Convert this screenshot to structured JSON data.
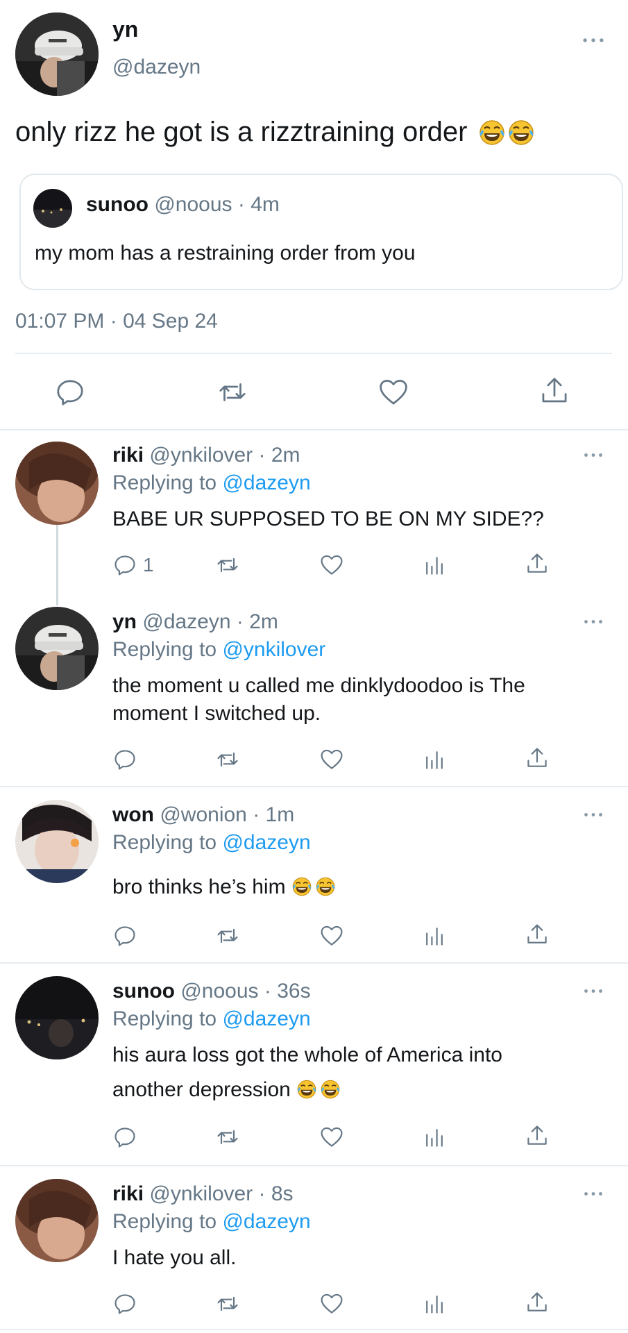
{
  "main_tweet": {
    "display_name": "yn",
    "handle": "@dazeyn",
    "text": "only rizz he got is a rizztraining order",
    "timestamp": "01:07 PM · 04 Sep 24",
    "quoted": {
      "display_name": "sunoo",
      "handle": "@noous",
      "age": "· 4m",
      "text": "my mom has a restraining order from you"
    }
  },
  "replying_prefix": "Replying to",
  "replies": [
    {
      "display_name": "riki",
      "handle": "@ynkilover",
      "age": "· 2m",
      "replying_to": "@dazeyn",
      "text": "BABE UR SUPPOSED TO BE ON MY SIDE??",
      "reply_count": "1"
    },
    {
      "display_name": "yn",
      "handle": "@dazeyn",
      "age": "· 2m",
      "replying_to": "@ynkilover",
      "text_line1": "the moment u called me dinklydoodoo is The",
      "text_line2": "moment I switched up."
    },
    {
      "display_name": "won",
      "handle": "@wonion",
      "age": "· 1m",
      "replying_to": "@dazeyn",
      "text": "bro thinks he’s him"
    },
    {
      "display_name": "sunoo",
      "handle": "@noous",
      "age": "· 36s",
      "replying_to": "@dazeyn",
      "text_line1": "his aura loss got the whole of America into",
      "text_line2": "another depression"
    },
    {
      "display_name": "riki",
      "handle": "@ynkilover",
      "age": "· 8s",
      "replying_to": "@dazeyn",
      "text": "I hate you all."
    }
  ],
  "icons": [
    "more-icon",
    "reply-icon",
    "retweet-icon",
    "like-icon",
    "share-icon",
    "analytics-icon",
    "laughing-emoji"
  ],
  "colors": {
    "link": "#1d9bf0",
    "muted": "#657786",
    "divider": "#e6ecf0"
  }
}
